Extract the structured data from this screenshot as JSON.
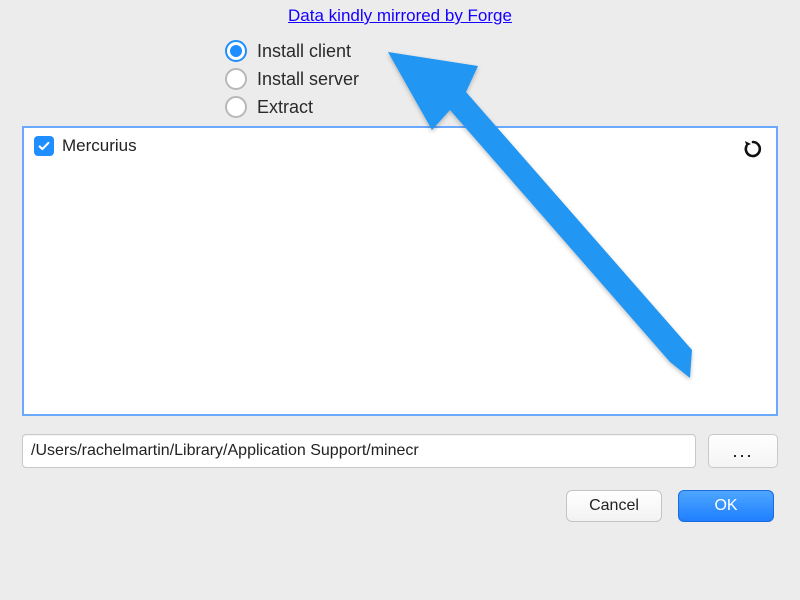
{
  "header": {
    "mirror_link": "Data kindly mirrored by Forge"
  },
  "options": {
    "install_client": "Install client",
    "install_server": "Install server",
    "extract": "Extract",
    "selected": "install_client"
  },
  "list": {
    "items": [
      {
        "label": "Mercurius",
        "checked": true
      }
    ]
  },
  "path": {
    "value": "/Users/rachelmartin/Library/Application Support/minecr",
    "browse_label": "..."
  },
  "buttons": {
    "cancel": "Cancel",
    "ok": "OK"
  },
  "colors": {
    "accent": "#1f8fff",
    "arrow": "#2196f3"
  }
}
